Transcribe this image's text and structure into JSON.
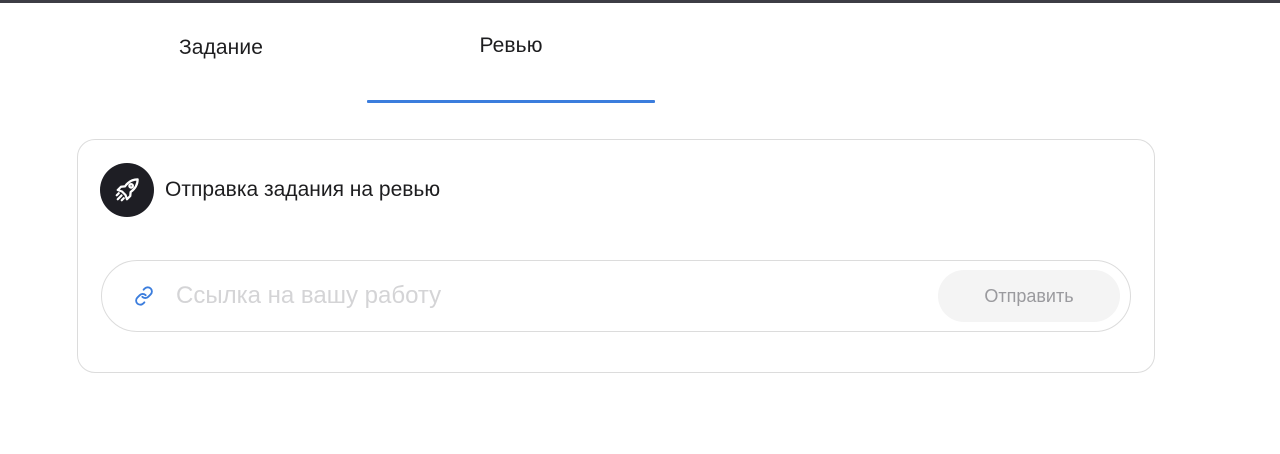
{
  "tabs": [
    {
      "label": "Задание",
      "active": false
    },
    {
      "label": "Ревью",
      "active": true
    }
  ],
  "card": {
    "icon": "rocket-icon",
    "title": "Отправка задания на ревью",
    "link_field": {
      "icon": "link-icon",
      "value": "",
      "placeholder": "Ссылка на вашу работу"
    },
    "submit_label": "Отправить"
  },
  "colors": {
    "accent": "#3b7ddd",
    "icon_bg": "#1e1e24",
    "border": "#dcdcdc",
    "button_bg": "#f4f4f4",
    "button_text": "#9a9a9e",
    "placeholder": "#d4d4d6",
    "top_strip": "#3d3d45"
  }
}
